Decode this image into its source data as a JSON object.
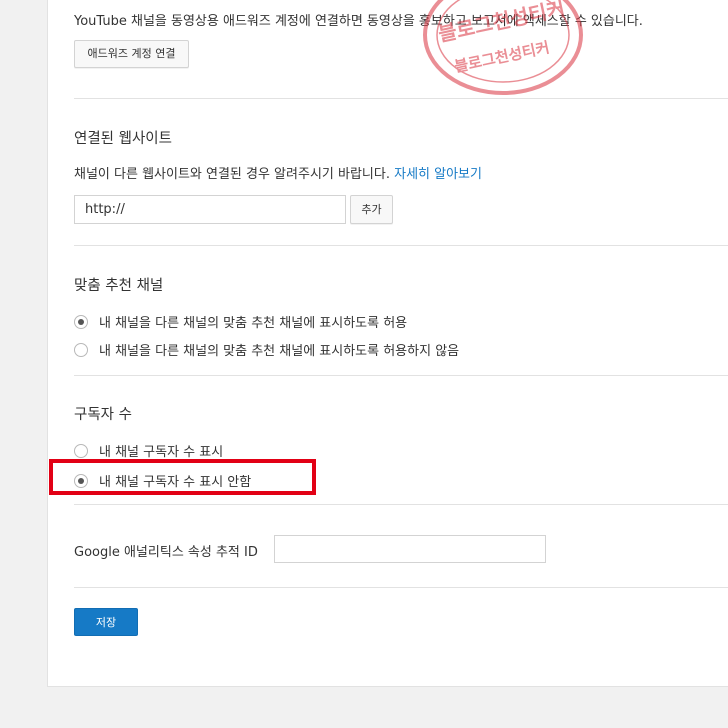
{
  "adwords": {
    "description": "YouTube 채널을 동영상용 애드워즈 계정에 연결하면 동영상을 홍보하고 보고서에 액세스할 수 있습니다.",
    "link_button": "애드워즈 계정 연결"
  },
  "website": {
    "title": "연결된 웹사이트",
    "description": "채널이 다른 웹사이트와 연결된 경우 알려주시기 바랍니다. ",
    "learn_more": "자세히 알아보기",
    "url_value": "http://",
    "add_button": "추가"
  },
  "featured_channels": {
    "title": "맞춤 추천 채널",
    "options": [
      {
        "label": "내 채널을 다른 채널의 맞춤 추천 채널에 표시하도록 허용",
        "checked": true
      },
      {
        "label": "내 채널을 다른 채널의 맞춤 추천 채널에 표시하도록 허용하지 않음",
        "checked": false
      }
    ]
  },
  "subscriber_count": {
    "title": "구독자 수",
    "options": [
      {
        "label": "내 채널 구독자 수 표시",
        "checked": false
      },
      {
        "label": "내 채널 구독자 수 표시 안함",
        "checked": true
      }
    ]
  },
  "analytics": {
    "label": "Google 애널리틱스 속성 추적 ID",
    "value": ""
  },
  "save_button": "저장",
  "watermark": {
    "text_top": "블로그천성티커",
    "text_bottom": "블로그천성티커"
  },
  "colors": {
    "accent": "#167ac6",
    "highlight": "#e20015",
    "background": "#f1f1f1"
  }
}
